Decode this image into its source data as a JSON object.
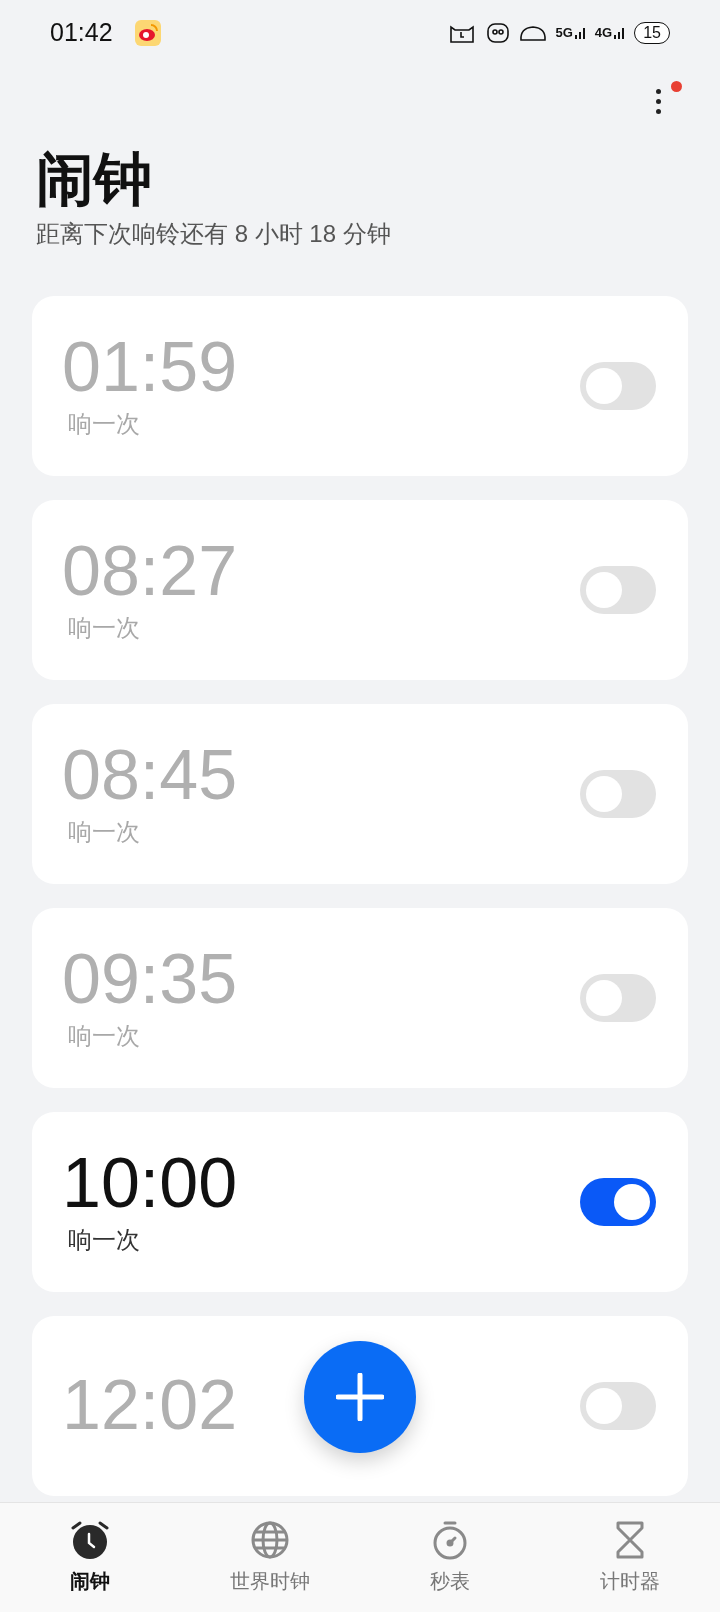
{
  "status_bar": {
    "time": "01:42",
    "network_5g": "5G",
    "network_4g": "4G",
    "battery": "15"
  },
  "header": {
    "title": "闹钟",
    "subtitle": "距离下次响铃还有 8 小时 18 分钟",
    "menu_badge": true
  },
  "alarms": [
    {
      "time": "01:59",
      "label": "响一次",
      "on": false
    },
    {
      "time": "08:27",
      "label": "响一次",
      "on": false
    },
    {
      "time": "08:45",
      "label": "响一次",
      "on": false
    },
    {
      "time": "09:35",
      "label": "响一次",
      "on": false
    },
    {
      "time": "10:00",
      "label": "响一次",
      "on": true
    },
    {
      "time": "12:02",
      "on": false
    }
  ],
  "tabs": [
    {
      "label": "闹钟",
      "kind": "alarm",
      "selected": true
    },
    {
      "label": "世界时钟",
      "kind": "globe",
      "selected": false
    },
    {
      "label": "秒表",
      "kind": "stopwatch",
      "selected": false
    },
    {
      "label": "计时器",
      "kind": "timer",
      "selected": false
    }
  ]
}
